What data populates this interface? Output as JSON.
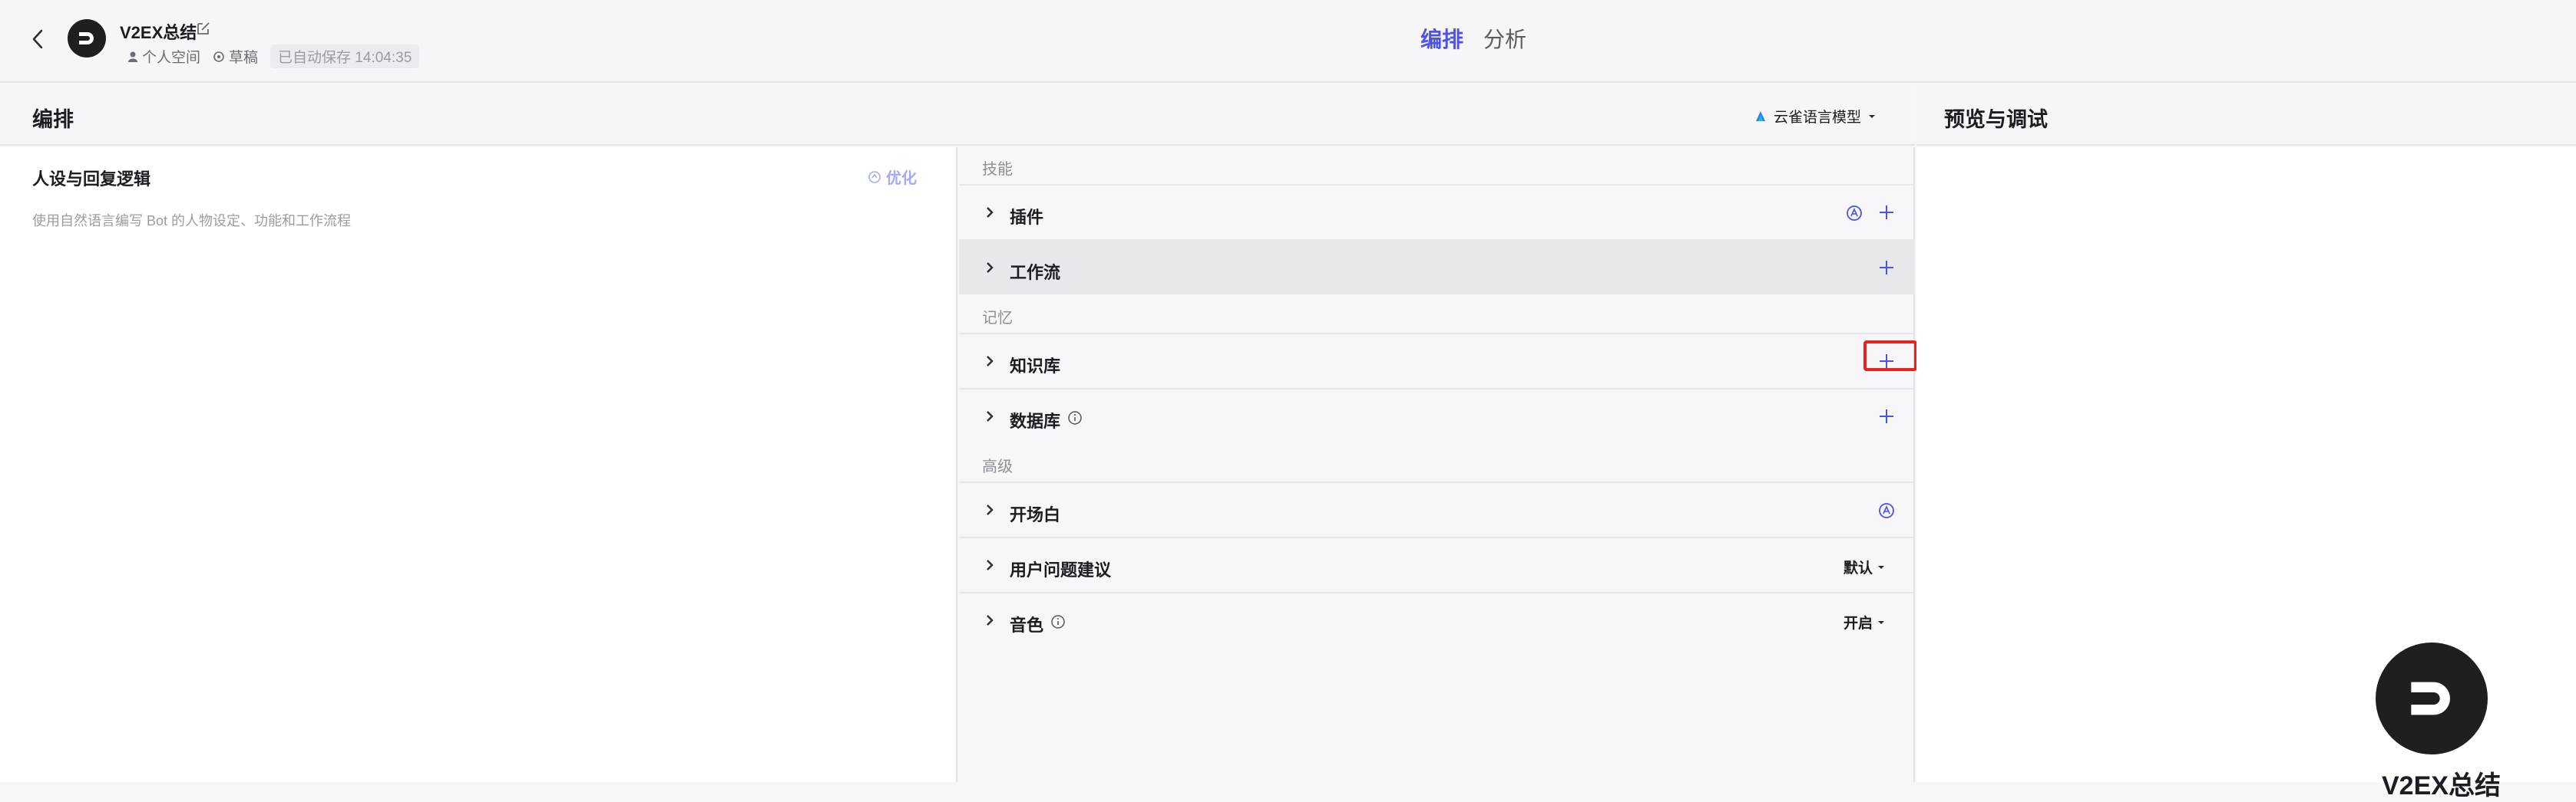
{
  "header": {
    "bot_name": "V2EX总结",
    "space": "个人空间",
    "status": "草稿",
    "saved": "已自动保存 14:04:35",
    "tabs": [
      {
        "label": "编排",
        "active": true
      },
      {
        "label": "分析",
        "active": false
      }
    ]
  },
  "edit_panel": {
    "title": "编排",
    "model": "云雀语言模型"
  },
  "prompt": {
    "title": "人设与回复逻辑",
    "optimize_label": "优化",
    "placeholder": "使用自然语言编写 Bot 的人物设定、功能和工作流程"
  },
  "skills": {
    "section_skills": "技能",
    "plugin": "插件",
    "workflow": "工作流",
    "section_memory": "记忆",
    "knowledge": "知识库",
    "database": "数据库",
    "section_advanced": "高级",
    "opening": "开场白",
    "suggestions": "用户问题建议",
    "suggestions_value": "默认",
    "voice": "音色",
    "voice_value": "开启"
  },
  "preview": {
    "title": "预览与调试",
    "bot_name": "V2EX总结"
  },
  "colors": {
    "accent": "#4d53e8",
    "highlight": "#e8231f"
  }
}
